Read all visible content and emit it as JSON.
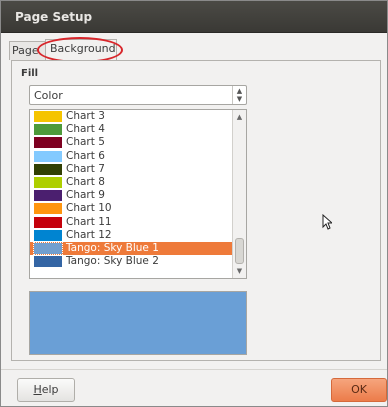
{
  "window": {
    "title": "Page Setup"
  },
  "tabs": [
    {
      "label": "Page"
    },
    {
      "label": "Background"
    }
  ],
  "fill": {
    "section_label": "Fill",
    "type_value": "Color"
  },
  "colors": [
    {
      "label": "Chart 3",
      "color": "#f5c400"
    },
    {
      "label": "Chart 4",
      "color": "#4d9a3a"
    },
    {
      "label": "Chart 5",
      "color": "#7e0021"
    },
    {
      "label": "Chart 6",
      "color": "#83caff"
    },
    {
      "label": "Chart 7",
      "color": "#314004"
    },
    {
      "label": "Chart 8",
      "color": "#aecf00"
    },
    {
      "label": "Chart 9",
      "color": "#4b1f6f"
    },
    {
      "label": "Chart 10",
      "color": "#ff950e"
    },
    {
      "label": "Chart 11",
      "color": "#c5000b"
    },
    {
      "label": "Chart 12",
      "color": "#0084d1"
    },
    {
      "label": "Tango: Sky Blue 1",
      "color": "#729fcf",
      "selected": true
    },
    {
      "label": "Tango: Sky Blue 2",
      "color": "#3465a4"
    }
  ],
  "preview": {
    "color": "#6a9fd6"
  },
  "buttons": {
    "help_prefix": "H",
    "help_rest": "elp",
    "ok": "OK"
  }
}
